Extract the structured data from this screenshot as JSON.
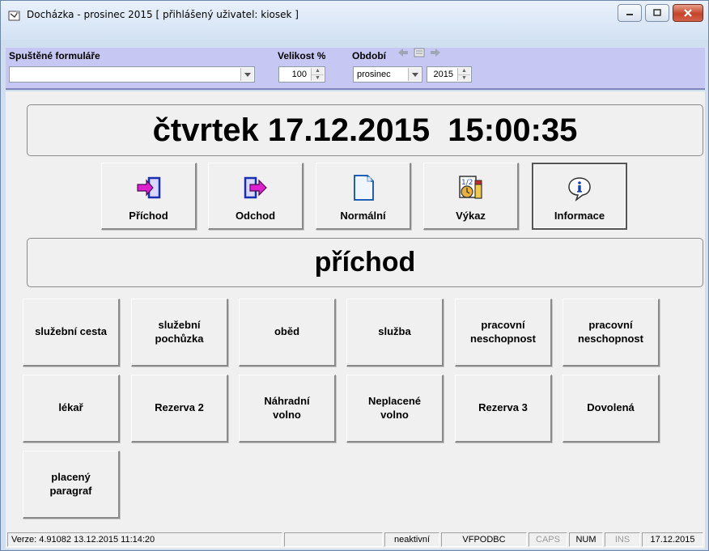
{
  "window": {
    "title": "Docházka - prosinec 2015  [ přihlášený uživatel: kiosek ]"
  },
  "toolbar": {
    "forms_label": "Spuštěné formuláře",
    "forms_value": "",
    "size_label": "Velikost %",
    "size_value": "100",
    "period_label": "Období",
    "month_value": "prosinec",
    "year_value": "2015"
  },
  "clock": {
    "text": "čtvrtek 17.12.2015  15:00:35"
  },
  "actions": [
    {
      "label": "Příchod",
      "icon": "arrival-icon"
    },
    {
      "label": "Odchod",
      "icon": "departure-icon"
    },
    {
      "label": "Normální",
      "icon": "document-icon"
    },
    {
      "label": "Výkaz",
      "icon": "report-icon"
    },
    {
      "label": "Informace",
      "icon": "info-icon"
    }
  ],
  "mode": {
    "text": "příchod"
  },
  "reasons": [
    "služební cesta",
    "služební\npochůzka",
    "oběd",
    "služba",
    "pracovní\nneschopnost",
    "pracovní\nneschopnost",
    "lékař",
    "Rezerva 2",
    "Náhradní\nvolno",
    "Neplacené\nvolno",
    "Rezerva 3",
    "Dovolená",
    "placený\nparagraf"
  ],
  "status": {
    "version": "Verze: 4.91082   13.12.2015 11:14:20",
    "empty": "",
    "state": "neaktivní",
    "db": "VFPODBC",
    "caps": "CAPS",
    "num": "NUM",
    "ins": "INS",
    "date": "17.12.2015"
  },
  "colors": {
    "toolbar_band": "#c7c7f4",
    "arrow_magenta": "#e01fd0",
    "arrow_blue": "#1a4fd0"
  }
}
